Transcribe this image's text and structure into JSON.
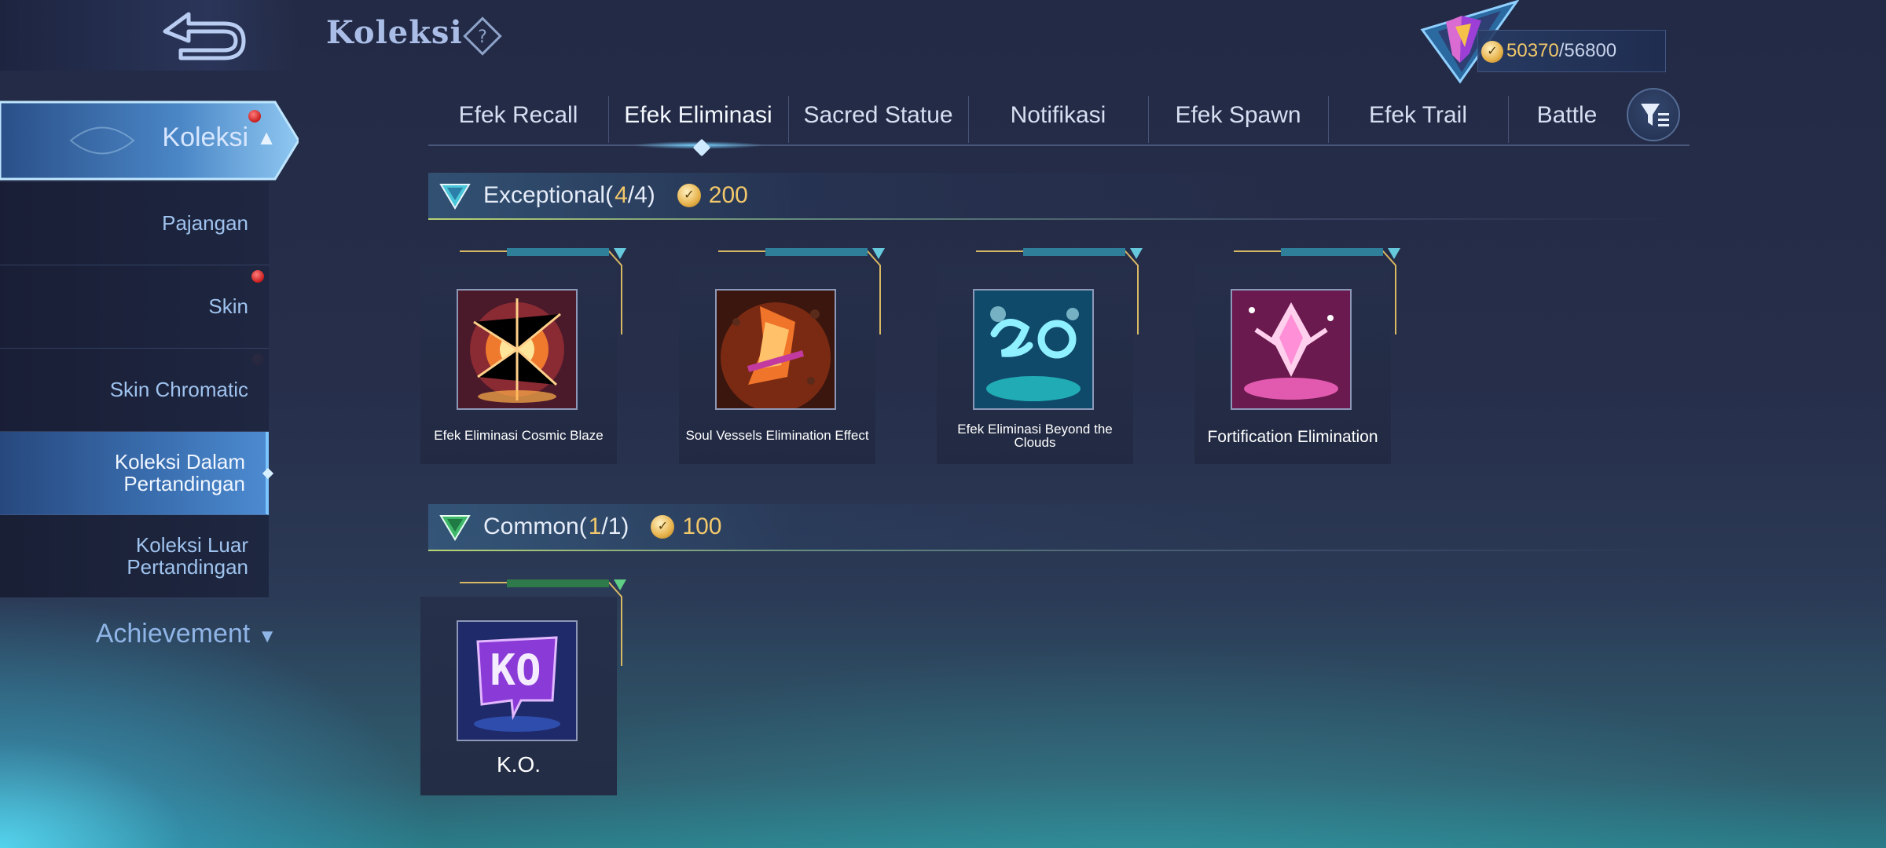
{
  "header": {
    "title": "Koleksi",
    "currency_current": "50370",
    "currency_max": "/56800"
  },
  "sidebar": {
    "main_label": "Koleksi",
    "items": [
      {
        "label": "Pajangan"
      },
      {
        "label": "Skin"
      },
      {
        "label": "Skin Chromatic"
      },
      {
        "label": "Koleksi Dalam Pertandingan"
      },
      {
        "label": "Koleksi Luar Pertandingan"
      }
    ],
    "achievement_label": "Achievement"
  },
  "tabs": [
    {
      "label": "Efek Recall"
    },
    {
      "label": "Efek Eliminasi"
    },
    {
      "label": "Sacred Statue"
    },
    {
      "label": "Notifikasi"
    },
    {
      "label": "Efek Spawn"
    },
    {
      "label": "Efek Trail"
    },
    {
      "label": "Battle"
    }
  ],
  "sections": {
    "exceptional": {
      "name": "Exceptional(",
      "owned": "4",
      "total": "/4)",
      "points": "200",
      "items": [
        {
          "name": "Efek Eliminasi Cosmic Blaze"
        },
        {
          "name": "Soul Vessels Elimination Effect"
        },
        {
          "name": "Efek Eliminasi Beyond the Clouds"
        },
        {
          "name": "Fortification Elimination"
        }
      ]
    },
    "common": {
      "name": "Common(",
      "owned": "1",
      "total": "/1)",
      "points": "100",
      "items": [
        {
          "name": "K.O."
        }
      ]
    }
  },
  "colors": {
    "accent_gold": "#f2c86a",
    "tab_active_glow": "#78d2ff",
    "sidebar_active": "#3a6fb0"
  },
  "icons": {
    "back": "back-arrow-icon",
    "help": "help-diamond-icon",
    "filter": "filter-icon",
    "coin": "coin-icon",
    "rank": "rank-emblem-icon"
  }
}
